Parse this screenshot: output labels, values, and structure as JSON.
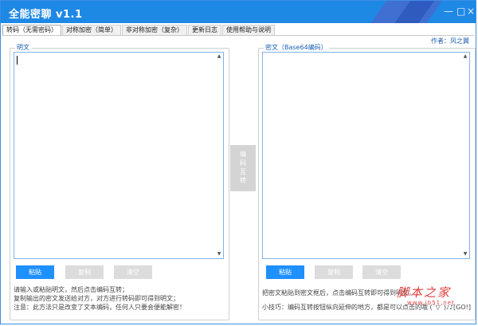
{
  "window": {
    "title": "全能密聊 v1.1",
    "controls": {
      "minimize": "—",
      "maximize": "□",
      "close": "×"
    }
  },
  "tabs": [
    {
      "label": "转码（无需密码）"
    },
    {
      "label": "对称加密（简单）"
    },
    {
      "label": "非对称加密（复杂）"
    },
    {
      "label": "更新日志"
    },
    {
      "label": "使用帮助与说明"
    }
  ],
  "author": "作者：风之翼",
  "left": {
    "legend": "明文",
    "buttons": {
      "paste": "粘贴",
      "copy": "复制",
      "clear": "清空"
    },
    "notes": [
      "请输入或粘贴明文，然后点击编码互转；",
      "复制输出的密文发送给对方，对方进行转码即可得到明文；",
      "注意：此方法只是改变了文本编码，任何人只要会便能解密！"
    ]
  },
  "right": {
    "legend": "密文（Base64编码）",
    "buttons": {
      "paste": "粘贴",
      "copy": "复制",
      "clear": "清空"
    },
    "notes": [
      "把密文粘贴到密文框后，点击编码互转即可得到明文。",
      "小技巧：编码互转按钮纵向延伸的地方，都是可以点击的哦 (´▽`)ﾉ♪[GO!]"
    ]
  },
  "convert_button": "编码互转",
  "watermark": {
    "main": "脚本之家",
    "sub": "www.jb51.net"
  },
  "colors": {
    "accent": "#1e88e5",
    "primary_button": "#1e90ff",
    "disabled_button": "#dcdcdc",
    "watermark": "#e23b3b"
  }
}
